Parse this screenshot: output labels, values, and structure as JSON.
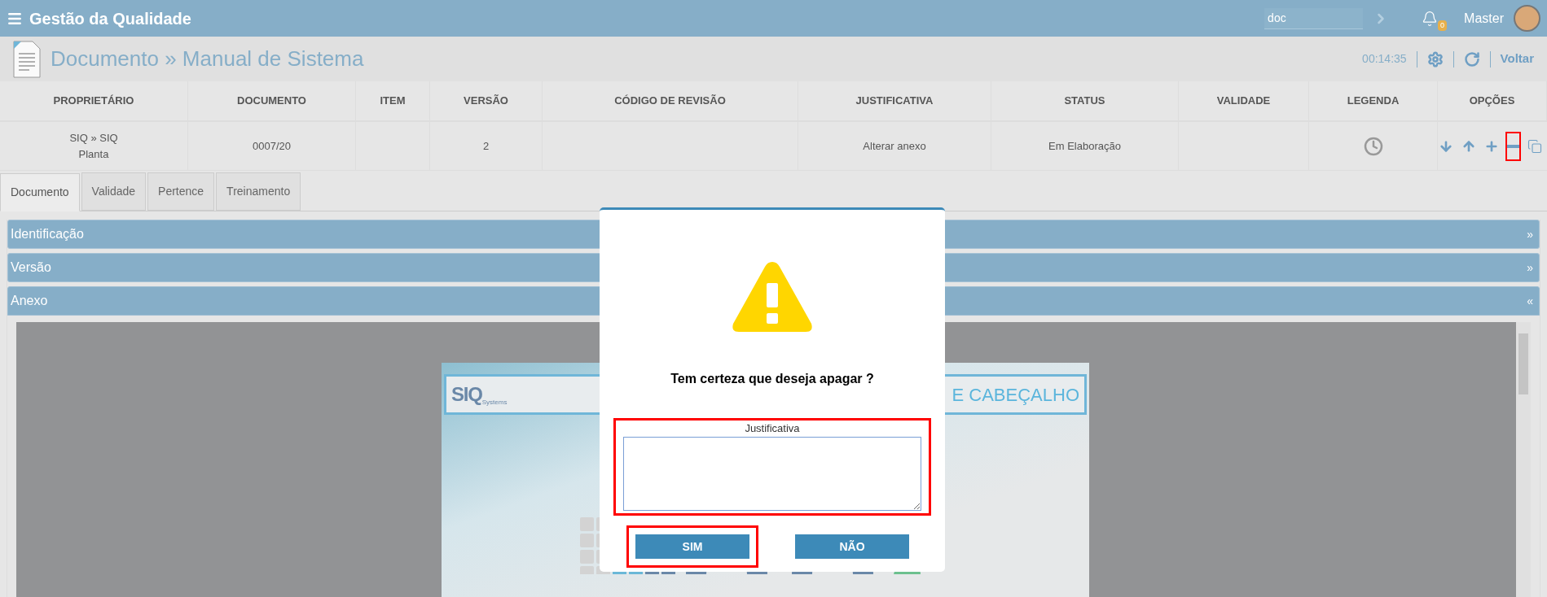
{
  "topbar": {
    "title": "Gestão da Qualidade",
    "search_value": "doc",
    "notifications": "0",
    "user": "Master"
  },
  "header": {
    "title": "Documento » Manual de Sistema",
    "timer": "00:14:35",
    "back": "Voltar"
  },
  "table": {
    "columns": [
      "PROPRIETÁRIO",
      "DOCUMENTO",
      "ITEM",
      "VERSÃO",
      "CÓDIGO DE REVISÃO",
      "JUSTIFICATIVA",
      "STATUS",
      "VALIDADE",
      "LEGENDA",
      "OPÇÕES"
    ],
    "row": {
      "owner": [
        "SIQ » SIQ",
        "Planta"
      ],
      "document": "0007/20",
      "version": "2",
      "justification": "Alterar anexo",
      "status": "Em Elaboração",
      "options": [
        {
          "kind": "down",
          "highlighted": false
        },
        {
          "kind": "up",
          "highlighted": false
        },
        {
          "kind": "add",
          "highlighted": false
        },
        {
          "kind": "remove",
          "highlighted": true
        },
        {
          "kind": "copy",
          "highlighted": false
        }
      ]
    }
  },
  "tabs": [
    {
      "label": "Documento",
      "selected": true
    },
    {
      "label": "Validade",
      "selected": false
    },
    {
      "label": "Pertence",
      "selected": false
    },
    {
      "label": "Treinamento",
      "selected": false
    }
  ],
  "sections": [
    {
      "title": "Identificação",
      "toggle": "»",
      "expanded": false
    },
    {
      "title": "Versão",
      "toggle": "»",
      "expanded": false
    },
    {
      "title": "Anexo",
      "toggle": "«",
      "expanded": true
    }
  ],
  "viewer": {
    "logo": "SIQ",
    "logo_sub": "Systems",
    "header_text": "E CABEÇALHO"
  },
  "dialog": {
    "message": "Tem certeza que deseja apagar ?",
    "field": {
      "label": "Justificativa",
      "highlighted": true
    },
    "buttons": [
      {
        "label": "SIM",
        "highlighted": true
      },
      {
        "label": "NÃO",
        "highlighted": false
      }
    ]
  }
}
